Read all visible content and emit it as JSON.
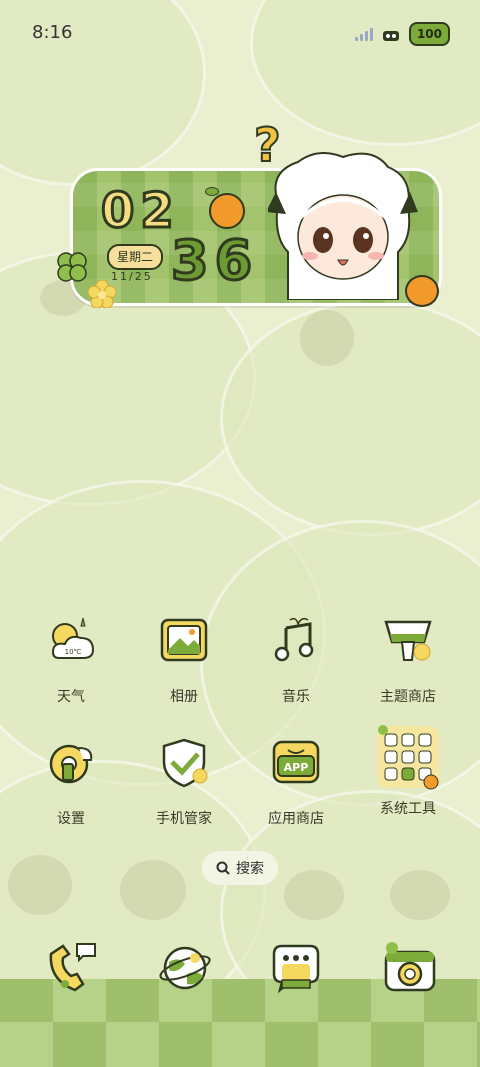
{
  "status_bar": {
    "time": "8:16",
    "battery": "100",
    "icons": [
      "signal-icon",
      "wifi-icon",
      "battery-icon"
    ]
  },
  "widget": {
    "hour": "02",
    "minute": "36",
    "weekday": "星期二",
    "date": "11/25"
  },
  "apps": [
    {
      "label": "天气",
      "icon": "weather-icon",
      "icon_text": "10℃"
    },
    {
      "label": "相册",
      "icon": "gallery-icon"
    },
    {
      "label": "音乐",
      "icon": "music-icon"
    },
    {
      "label": "主题商店",
      "icon": "theme-store-icon"
    },
    {
      "label": "设置",
      "icon": "settings-icon"
    },
    {
      "label": "手机管家",
      "icon": "phone-manager-icon"
    },
    {
      "label": "应用商店",
      "icon": "app-store-icon",
      "icon_text": "APP"
    },
    {
      "label": "系统工具",
      "icon": "system-tools-folder-icon"
    }
  ],
  "search": {
    "label": "搜索"
  },
  "dock": [
    {
      "icon": "phone-icon"
    },
    {
      "icon": "browser-icon"
    },
    {
      "icon": "messages-icon"
    },
    {
      "icon": "camera-icon"
    }
  ],
  "colors": {
    "background": "#e9efcf",
    "accent_green": "#7cab3a",
    "accent_yellow": "#f6dc83",
    "outline": "#2f3a1f",
    "orange": "#f39a2c"
  }
}
